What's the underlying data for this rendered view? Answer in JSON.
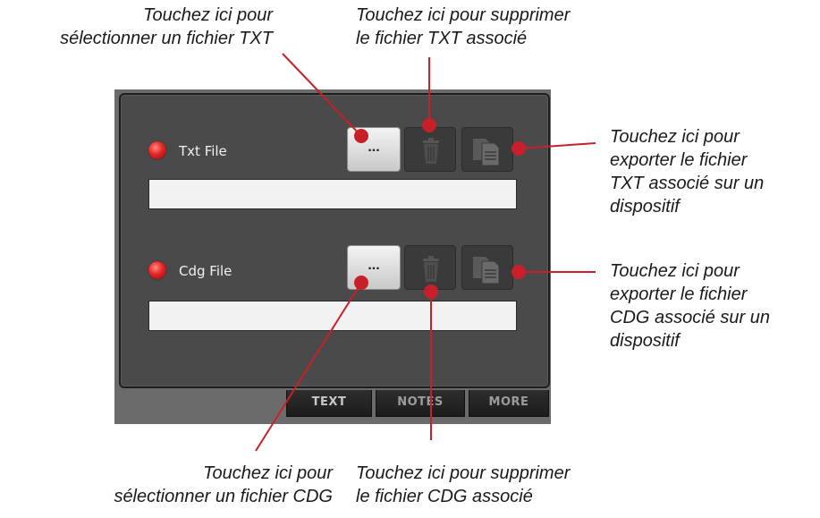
{
  "callouts": {
    "select_txt": [
      "Touchez ici pour",
      "sélectionner un fichier TXT"
    ],
    "delete_txt": [
      "Touchez ici pour supprimer",
      "le fichier TXT associé"
    ],
    "export_txt": [
      "Touchez ici pour",
      "exporter le fichier",
      "TXT associé sur un",
      "dispositif"
    ],
    "export_cdg": [
      "Touchez ici pour",
      "exporter le fichier",
      "CDG associé sur un",
      "dispositif"
    ],
    "select_cdg": [
      "Touchez ici pour",
      "sélectionner un fichier CDG"
    ],
    "delete_cdg": [
      "Touchez ici pour supprimer",
      "le fichier CDG associé"
    ]
  },
  "panel": {
    "txt": {
      "label": "Txt File",
      "browse_label": "...",
      "path_value": ""
    },
    "cdg": {
      "label": "Cdg File",
      "browse_label": "...",
      "path_value": ""
    },
    "tabs": [
      "TEXT",
      "NOTES",
      "MORE"
    ],
    "active_tab": "TEXT"
  },
  "icons": {
    "led": "red-led-icon",
    "delete": "trash-icon",
    "export": "export-documents-icon"
  },
  "colors": {
    "callout_line": "#c8202a",
    "led": "#e32424",
    "panel": "#4a4a4a"
  }
}
